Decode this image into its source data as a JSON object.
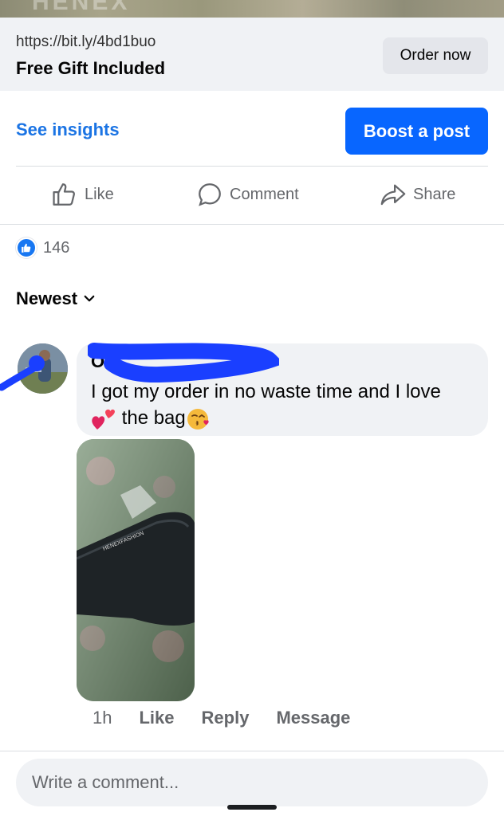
{
  "banner": {
    "text": "HENEX"
  },
  "link_card": {
    "url": "https://bit.ly/4bd1buo",
    "title": "Free Gift Included",
    "cta_label": "Order now"
  },
  "post_actions": {
    "insights_label": "See insights",
    "boost_label": "Boost a post",
    "like_label": "Like",
    "comment_label": "Comment",
    "share_label": "Share"
  },
  "reactions": {
    "count": "146"
  },
  "sort": {
    "label": "Newest"
  },
  "comment": {
    "author": "O",
    "text_line1": "I got my order in no waste time and I love",
    "text_line2": "the bag",
    "photo_brand": "HENEXFASHION",
    "time": "1h",
    "like_label": "Like",
    "reply_label": "Reply",
    "message_label": "Message"
  },
  "composer": {
    "placeholder": "Write a comment..."
  },
  "colors": {
    "accent": "#0866ff",
    "link_blue": "#1b74e4",
    "secondary_text": "#65676b",
    "bubble_bg": "#f0f2f5",
    "redaction": "#1a3fff"
  },
  "icons": [
    "thumbs-up-icon",
    "comment-icon",
    "share-icon",
    "like-badge-icon",
    "chevron-down-icon",
    "heart-icon",
    "kissing-face-icon"
  ]
}
